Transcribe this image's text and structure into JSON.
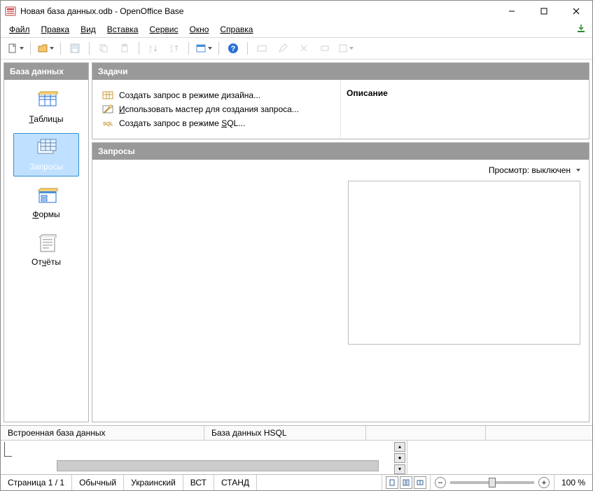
{
  "title": "Новая база данных.odb - OpenOffice Base",
  "menu": {
    "file": "Файл",
    "edit": "Правка",
    "view": "Вид",
    "insert": "Вставка",
    "service": "Сервис",
    "window": "Окно",
    "help": "Справка"
  },
  "sidebar": {
    "header": "База данных",
    "items": [
      {
        "label": "Таблицы"
      },
      {
        "label": "Запросы"
      },
      {
        "label": "Формы"
      },
      {
        "label": "Отчёты"
      }
    ]
  },
  "tasks": {
    "header": "Задачи",
    "items": [
      {
        "label": "Создать запрос в режиме дизайна..."
      },
      {
        "label": "Использовать мастер для создания запроса..."
      },
      {
        "label": "Создать запрос в режиме SQL..."
      }
    ],
    "descHeader": "Описание"
  },
  "queries": {
    "header": "Запросы",
    "previewLabel": "Просмотр: выключен"
  },
  "status1": {
    "embedded": "Встроенная база данных",
    "engine": "База данных HSQL"
  },
  "status2": {
    "page": "Страница  1 / 1",
    "mode": "Обычный",
    "lang": "Украинский",
    "ins": "ВСТ",
    "std": "СТАНД",
    "zoom": "100 %"
  }
}
